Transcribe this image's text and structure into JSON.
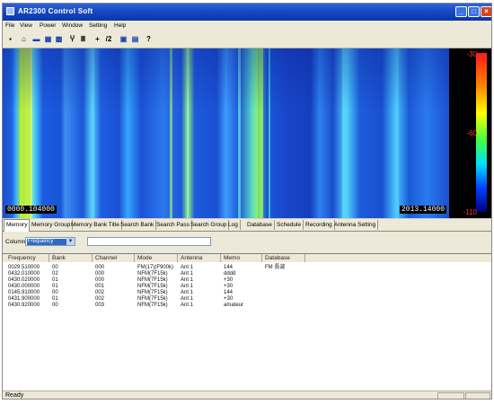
{
  "window": {
    "title": "AR2300 Control Soft"
  },
  "menu": [
    "File",
    "View",
    "Power",
    "Window",
    "Setting",
    "Help"
  ],
  "toolbar": [
    {
      "icon": "save-icon",
      "glyph": "▪"
    },
    {
      "icon": "antenna-icon",
      "glyph": "⌂"
    },
    {
      "icon": "receiver-icon",
      "glyph": "▬"
    },
    {
      "icon": "memory-icon",
      "glyph": "▦"
    },
    {
      "icon": "spectrum-icon",
      "glyph": "▩"
    },
    {
      "icon": "scan-icon",
      "glyph": "Ⴤ"
    },
    {
      "icon": "bars-icon",
      "glyph": "Ⅲ"
    },
    {
      "icon": "add-icon",
      "glyph": "+"
    },
    {
      "icon": "divide-icon",
      "glyph": "/2"
    },
    {
      "icon": "display-icon",
      "glyph": "▣"
    },
    {
      "icon": "window-icon",
      "glyph": "▤"
    },
    {
      "icon": "help-icon",
      "glyph": "?"
    }
  ],
  "waterfall": {
    "start_freq": "0000.104000",
    "end_freq": "2013.14000",
    "scale_top": "-30",
    "scale_mid": "-60",
    "scale_bottom": "-110"
  },
  "tabs": [
    "Memory",
    "Memory Group",
    "Memory Bank Title",
    "Search Bank",
    "Search Pass",
    "Search Group",
    "Log",
    "Database",
    "Schedule",
    "Recording",
    "Antenna Setting"
  ],
  "filter": {
    "label": "Column",
    "selected": "Frequency",
    "input_value": ""
  },
  "table": {
    "columns": [
      "Frequency",
      "Bank",
      "Channel",
      "Mode",
      "Antenna",
      "Memo",
      "Database"
    ],
    "rows": [
      [
        "0029.510000",
        "00",
        "000",
        "FM(17)(F900k)",
        "Ant 1",
        "144",
        "FM 長波"
      ],
      [
        "0432.010000",
        "02",
        "000",
        "NFM(7F15k)",
        "Ant 1",
        "dddd",
        ""
      ],
      [
        "0430.020000",
        "01",
        "000",
        "NFM(7F15k)",
        "Ant 1",
        "+30",
        ""
      ],
      [
        "0430.000000",
        "01",
        "001",
        "NFM(7F15k)",
        "Ant 1",
        "+30",
        ""
      ],
      [
        "0145.910000",
        "00",
        "002",
        "NFM(7F15k)",
        "Ant 1",
        "144",
        ""
      ],
      [
        "0431.900000",
        "01",
        "002",
        "NFM(7F15k)",
        "Ant 1",
        "+30",
        ""
      ],
      [
        "0430.920000",
        "00",
        "003",
        "NFM(7F15k)",
        "Ant 1",
        "amateur",
        ""
      ]
    ]
  },
  "status": {
    "text": "Ready"
  }
}
